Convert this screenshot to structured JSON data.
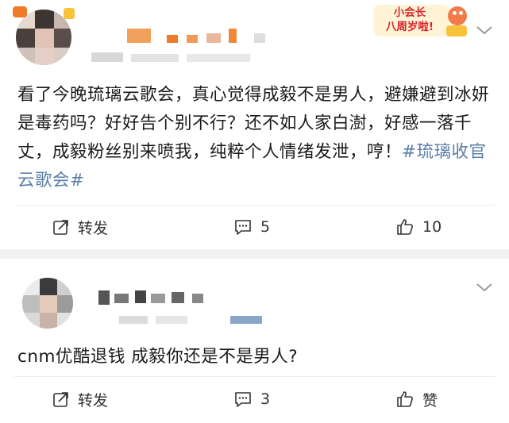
{
  "posts": [
    {
      "text_before_tag": "看了今晚琉璃云歌会，真心觉得成毅不是男人，避嫌避到冰妍是毒药吗？好好告个别不行？还不如人家白澍，好感一落千丈，成毅粉丝别来喷我，纯粹个人情绪发泄，哼！",
      "hashtag": "#琉璃收官云歌会#",
      "repost_label": "转发",
      "comment_count": "5",
      "like_label": "10",
      "badge_line1": "小会长",
      "badge_line2": "八周岁啦!"
    },
    {
      "text": "cnm优酷退钱 成毅你还是不是男人?",
      "repost_label": "转发",
      "comment_count": "3",
      "like_label": "赞"
    }
  ],
  "icons": {
    "repost": "repost-icon",
    "comment": "comment-icon",
    "like": "thumbs-up-icon",
    "more": "chevron-down-icon"
  },
  "colors": {
    "hashtag": "#5b7ea6",
    "divider": "#f2f2f2",
    "badge_red": "#d8232a"
  }
}
